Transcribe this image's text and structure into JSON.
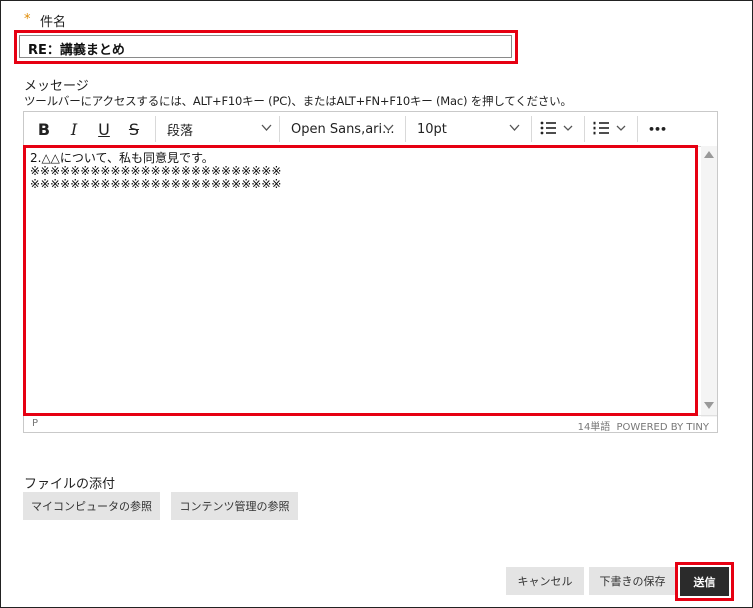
{
  "subject": {
    "required_mark": "*",
    "label": "件名",
    "value": "RE：講義まとめ"
  },
  "message": {
    "label": "メッセージ",
    "help": "ツールバーにアクセスするには、ALT+F10キー (PC)、またはALT+FN+F10キー (Mac) を押してください。"
  },
  "toolbar": {
    "bold": "B",
    "italic": "I",
    "underline": "U",
    "strike": "S",
    "block_format": "段落",
    "font_family": "Open Sans,ari...",
    "font_size": "10pt",
    "more": "•••"
  },
  "editor": {
    "lines": [
      "2.△△について、私も同意見です。",
      "※※※※※※※※※※※※※※※※※※※※※※※※※",
      "※※※※※※※※※※※※※※※※※※※※※※※※※"
    ],
    "status_path": "P",
    "word_count": "14単語",
    "powered_by": "POWERED BY TINY"
  },
  "attachments": {
    "label": "ファイルの添付",
    "browse_computer": "マイコンピュータの参照",
    "browse_content": "コンテンツ管理の参照"
  },
  "actions": {
    "cancel": "キャンセル",
    "save_draft": "下書きの保存",
    "send": "送信"
  },
  "colors": {
    "highlight": "#e60012",
    "required": "#e08a00",
    "send_bg": "#2b2b2b"
  }
}
